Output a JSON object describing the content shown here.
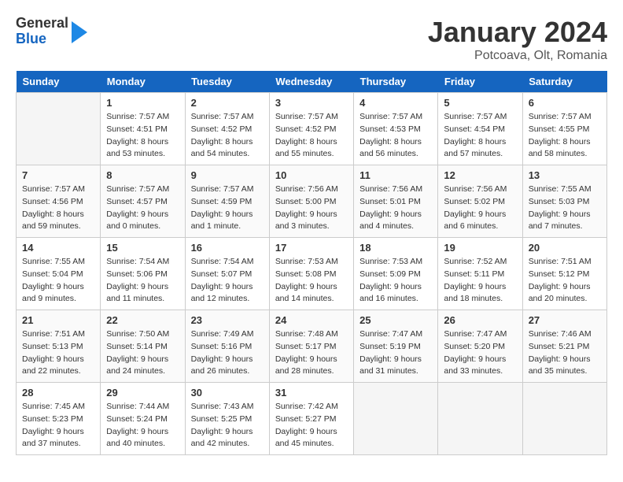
{
  "header": {
    "logo_general": "General",
    "logo_blue": "Blue",
    "title": "January 2024",
    "subtitle": "Potcoava, Olt, Romania"
  },
  "weekdays": [
    "Sunday",
    "Monday",
    "Tuesday",
    "Wednesday",
    "Thursday",
    "Friday",
    "Saturday"
  ],
  "weeks": [
    [
      {
        "day": "",
        "empty": true
      },
      {
        "day": "1",
        "sunrise": "7:57 AM",
        "sunset": "4:51 PM",
        "daylight": "8 hours and 53 minutes."
      },
      {
        "day": "2",
        "sunrise": "7:57 AM",
        "sunset": "4:52 PM",
        "daylight": "8 hours and 54 minutes."
      },
      {
        "day": "3",
        "sunrise": "7:57 AM",
        "sunset": "4:52 PM",
        "daylight": "8 hours and 55 minutes."
      },
      {
        "day": "4",
        "sunrise": "7:57 AM",
        "sunset": "4:53 PM",
        "daylight": "8 hours and 56 minutes."
      },
      {
        "day": "5",
        "sunrise": "7:57 AM",
        "sunset": "4:54 PM",
        "daylight": "8 hours and 57 minutes."
      },
      {
        "day": "6",
        "sunrise": "7:57 AM",
        "sunset": "4:55 PM",
        "daylight": "8 hours and 58 minutes."
      }
    ],
    [
      {
        "day": "7",
        "sunrise": "7:57 AM",
        "sunset": "4:56 PM",
        "daylight": "8 hours and 59 minutes."
      },
      {
        "day": "8",
        "sunrise": "7:57 AM",
        "sunset": "4:57 PM",
        "daylight": "9 hours and 0 minutes."
      },
      {
        "day": "9",
        "sunrise": "7:57 AM",
        "sunset": "4:59 PM",
        "daylight": "9 hours and 1 minute."
      },
      {
        "day": "10",
        "sunrise": "7:56 AM",
        "sunset": "5:00 PM",
        "daylight": "9 hours and 3 minutes."
      },
      {
        "day": "11",
        "sunrise": "7:56 AM",
        "sunset": "5:01 PM",
        "daylight": "9 hours and 4 minutes."
      },
      {
        "day": "12",
        "sunrise": "7:56 AM",
        "sunset": "5:02 PM",
        "daylight": "9 hours and 6 minutes."
      },
      {
        "day": "13",
        "sunrise": "7:55 AM",
        "sunset": "5:03 PM",
        "daylight": "9 hours and 7 minutes."
      }
    ],
    [
      {
        "day": "14",
        "sunrise": "7:55 AM",
        "sunset": "5:04 PM",
        "daylight": "9 hours and 9 minutes."
      },
      {
        "day": "15",
        "sunrise": "7:54 AM",
        "sunset": "5:06 PM",
        "daylight": "9 hours and 11 minutes."
      },
      {
        "day": "16",
        "sunrise": "7:54 AM",
        "sunset": "5:07 PM",
        "daylight": "9 hours and 12 minutes."
      },
      {
        "day": "17",
        "sunrise": "7:53 AM",
        "sunset": "5:08 PM",
        "daylight": "9 hours and 14 minutes."
      },
      {
        "day": "18",
        "sunrise": "7:53 AM",
        "sunset": "5:09 PM",
        "daylight": "9 hours and 16 minutes."
      },
      {
        "day": "19",
        "sunrise": "7:52 AM",
        "sunset": "5:11 PM",
        "daylight": "9 hours and 18 minutes."
      },
      {
        "day": "20",
        "sunrise": "7:51 AM",
        "sunset": "5:12 PM",
        "daylight": "9 hours and 20 minutes."
      }
    ],
    [
      {
        "day": "21",
        "sunrise": "7:51 AM",
        "sunset": "5:13 PM",
        "daylight": "9 hours and 22 minutes."
      },
      {
        "day": "22",
        "sunrise": "7:50 AM",
        "sunset": "5:14 PM",
        "daylight": "9 hours and 24 minutes."
      },
      {
        "day": "23",
        "sunrise": "7:49 AM",
        "sunset": "5:16 PM",
        "daylight": "9 hours and 26 minutes."
      },
      {
        "day": "24",
        "sunrise": "7:48 AM",
        "sunset": "5:17 PM",
        "daylight": "9 hours and 28 minutes."
      },
      {
        "day": "25",
        "sunrise": "7:47 AM",
        "sunset": "5:19 PM",
        "daylight": "9 hours and 31 minutes."
      },
      {
        "day": "26",
        "sunrise": "7:47 AM",
        "sunset": "5:20 PM",
        "daylight": "9 hours and 33 minutes."
      },
      {
        "day": "27",
        "sunrise": "7:46 AM",
        "sunset": "5:21 PM",
        "daylight": "9 hours and 35 minutes."
      }
    ],
    [
      {
        "day": "28",
        "sunrise": "7:45 AM",
        "sunset": "5:23 PM",
        "daylight": "9 hours and 37 minutes."
      },
      {
        "day": "29",
        "sunrise": "7:44 AM",
        "sunset": "5:24 PM",
        "daylight": "9 hours and 40 minutes."
      },
      {
        "day": "30",
        "sunrise": "7:43 AM",
        "sunset": "5:25 PM",
        "daylight": "9 hours and 42 minutes."
      },
      {
        "day": "31",
        "sunrise": "7:42 AM",
        "sunset": "5:27 PM",
        "daylight": "9 hours and 45 minutes."
      },
      {
        "day": "",
        "empty": true
      },
      {
        "day": "",
        "empty": true
      },
      {
        "day": "",
        "empty": true
      }
    ]
  ],
  "labels": {
    "sunrise": "Sunrise:",
    "sunset": "Sunset:",
    "daylight": "Daylight:"
  }
}
